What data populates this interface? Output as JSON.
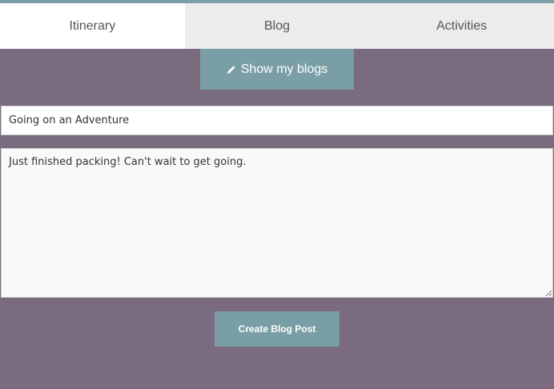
{
  "tabs": [
    {
      "label": "Itinerary"
    },
    {
      "label": "Blog"
    },
    {
      "label": "Activities"
    }
  ],
  "show_blogs": {
    "label": "Show my blogs",
    "icon": "pencil-icon"
  },
  "post": {
    "title_value": "Going on an Adventure",
    "body_value": "Just finished packing! Can't wait to get going."
  },
  "create_button": {
    "label": "Create Blog Post"
  },
  "colors": {
    "background": "#7a6b7f",
    "accent": "#7a9ea6",
    "tab_active": "#ffffff",
    "tab_inactive": "#ececec"
  }
}
